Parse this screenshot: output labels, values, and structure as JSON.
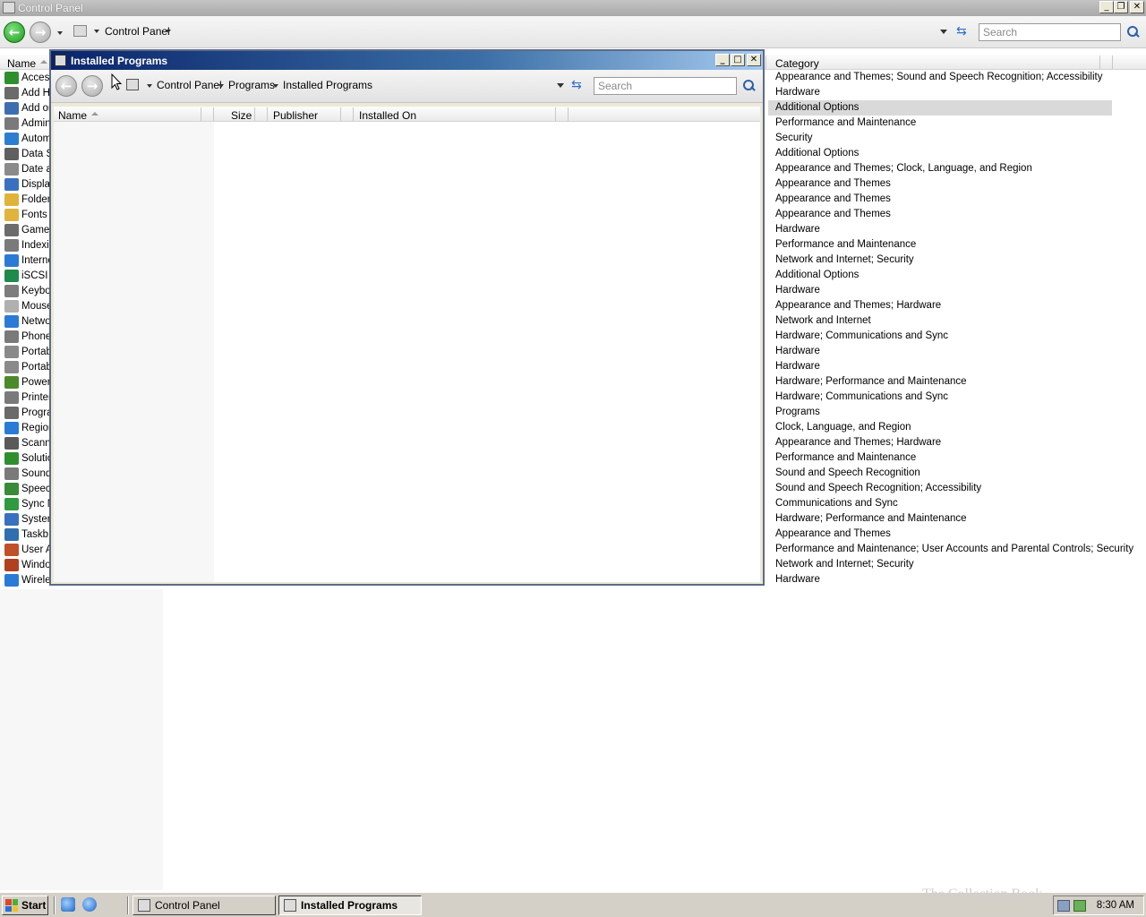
{
  "cp_window": {
    "title": "Control Panel",
    "breadcrumb": [
      "Control Panel"
    ],
    "search_placeholder": "Search",
    "list": {
      "col_name": "Name",
      "col_category": "Category",
      "items": [
        {
          "label": "Acces",
          "category": "Appearance and Themes; Sound and Speech Recognition; Accessibility",
          "icon": "accessibility-icon",
          "color": "#2f8f2f"
        },
        {
          "label": "Add H",
          "category": "Hardware",
          "icon": "add-hardware-icon",
          "color": "#6b6b6b"
        },
        {
          "label": "Add or",
          "category": "Additional Options",
          "icon": "add-remove-programs-icon",
          "color": "#3d6fb0"
        },
        {
          "label": "Admin",
          "category": "Performance and Maintenance",
          "icon": "admin-tools-icon",
          "color": "#7a7a7a"
        },
        {
          "label": "Autom",
          "category": "Security",
          "icon": "automatic-updates-icon",
          "color": "#2c7fd0"
        },
        {
          "label": "Data S",
          "category": "Additional Options",
          "icon": "data-sources-icon",
          "color": "#606060"
        },
        {
          "label": "Date a",
          "category": "Appearance and Themes; Clock, Language, and Region",
          "icon": "date-time-icon",
          "color": "#8b8b8b"
        },
        {
          "label": "Displa",
          "category": "Appearance and Themes",
          "icon": "display-icon",
          "color": "#3a70c0"
        },
        {
          "label": "Folder",
          "category": "Appearance and Themes",
          "icon": "folder-options-icon",
          "color": "#e0b43a"
        },
        {
          "label": "Fonts",
          "category": "Appearance and Themes",
          "icon": "fonts-icon",
          "color": "#e0b43a"
        },
        {
          "label": "Game",
          "category": "Hardware",
          "icon": "game-controllers-icon",
          "color": "#6c6c6c"
        },
        {
          "label": "Indexi",
          "category": "Performance and Maintenance",
          "icon": "indexing-icon",
          "color": "#7a7a7a"
        },
        {
          "label": "Interne",
          "category": "Network and Internet; Security",
          "icon": "internet-options-icon",
          "color": "#2b7bd6"
        },
        {
          "label": "iSCSI",
          "category": "Additional Options",
          "icon": "iscsi-icon",
          "color": "#1f8a4b"
        },
        {
          "label": "Keybo",
          "category": "Hardware",
          "icon": "keyboard-icon",
          "color": "#7d7d7d"
        },
        {
          "label": "Mouse",
          "category": "Appearance and Themes; Hardware",
          "icon": "mouse-icon",
          "color": "#b0b0b0"
        },
        {
          "label": "Netwo",
          "category": "Network and Internet",
          "icon": "network-icon",
          "color": "#2b7bd6"
        },
        {
          "label": "Phone",
          "category": "Hardware; Communications and Sync",
          "icon": "phone-modem-icon",
          "color": "#7a7a7a"
        },
        {
          "label": "Portab",
          "category": "Hardware",
          "icon": "portable-media-icon",
          "color": "#8a8a8a"
        },
        {
          "label": "Portab",
          "category": "Hardware",
          "icon": "portable-media-icon",
          "color": "#8a8a8a"
        },
        {
          "label": "Power",
          "category": "Hardware; Performance and Maintenance",
          "icon": "power-options-icon",
          "color": "#4a8a2a"
        },
        {
          "label": "Printer",
          "category": "Hardware; Communications and Sync",
          "icon": "printers-icon",
          "color": "#7a7a7a"
        },
        {
          "label": "Progra",
          "category": "Programs",
          "icon": "programs-icon",
          "color": "#6a6a6a"
        },
        {
          "label": "Region",
          "category": "Clock, Language, and Region",
          "icon": "regional-options-icon",
          "color": "#2b7bd6"
        },
        {
          "label": "Scann",
          "category": "Appearance and Themes; Hardware",
          "icon": "scanners-icon",
          "color": "#5a5a5a"
        },
        {
          "label": "Solutio",
          "category": "Performance and Maintenance",
          "icon": "solutions-icon",
          "color": "#2f8f2f"
        },
        {
          "label": "Sound",
          "category": "Sound and Speech Recognition",
          "icon": "sound-icon",
          "color": "#7a7a7a"
        },
        {
          "label": "Speec",
          "category": "Sound and Speech Recognition; Accessibility",
          "icon": "speech-icon",
          "color": "#3a8a3a"
        },
        {
          "label": "Sync N",
          "category": "Communications and Sync",
          "icon": "sync-center-icon",
          "color": "#2f9a3f"
        },
        {
          "label": "Syster",
          "category": "Hardware; Performance and Maintenance",
          "icon": "system-icon",
          "color": "#3a70c0"
        },
        {
          "label": "Taskb",
          "category": "Appearance and Themes",
          "icon": "taskbar-icon",
          "color": "#2f6fb0"
        },
        {
          "label": "User A",
          "category": "Performance and Maintenance; User Accounts and Parental Controls; Security",
          "icon": "user-accounts-icon",
          "color": "#c0502a"
        },
        {
          "label": "Windo",
          "category": "Network and Internet; Security",
          "icon": "windows-firewall-icon",
          "color": "#b04020"
        },
        {
          "label": "Wirele",
          "category": "Hardware",
          "icon": "wireless-icon",
          "color": "#2b7bd6"
        }
      ]
    }
  },
  "ip_window": {
    "title": "Installed Programs",
    "breadcrumb": [
      "Control Panel",
      "Programs",
      "Installed Programs"
    ],
    "search_placeholder": "Search",
    "columns": [
      "Name",
      "Size",
      "Publisher",
      "Installed On"
    ]
  },
  "taskbar": {
    "start_label": "Start",
    "tasks": [
      {
        "label": "Control Panel",
        "active": false
      },
      {
        "label": "Installed Programs",
        "active": true
      }
    ],
    "clock": "8:30 AM"
  },
  "watermark": "The Collection Book",
  "colors": {
    "title_inactive": "#b0b0b0",
    "title_active_start": "#0a246a",
    "title_active_end": "#a6caf0",
    "selected_row": "#d9d9d9"
  }
}
